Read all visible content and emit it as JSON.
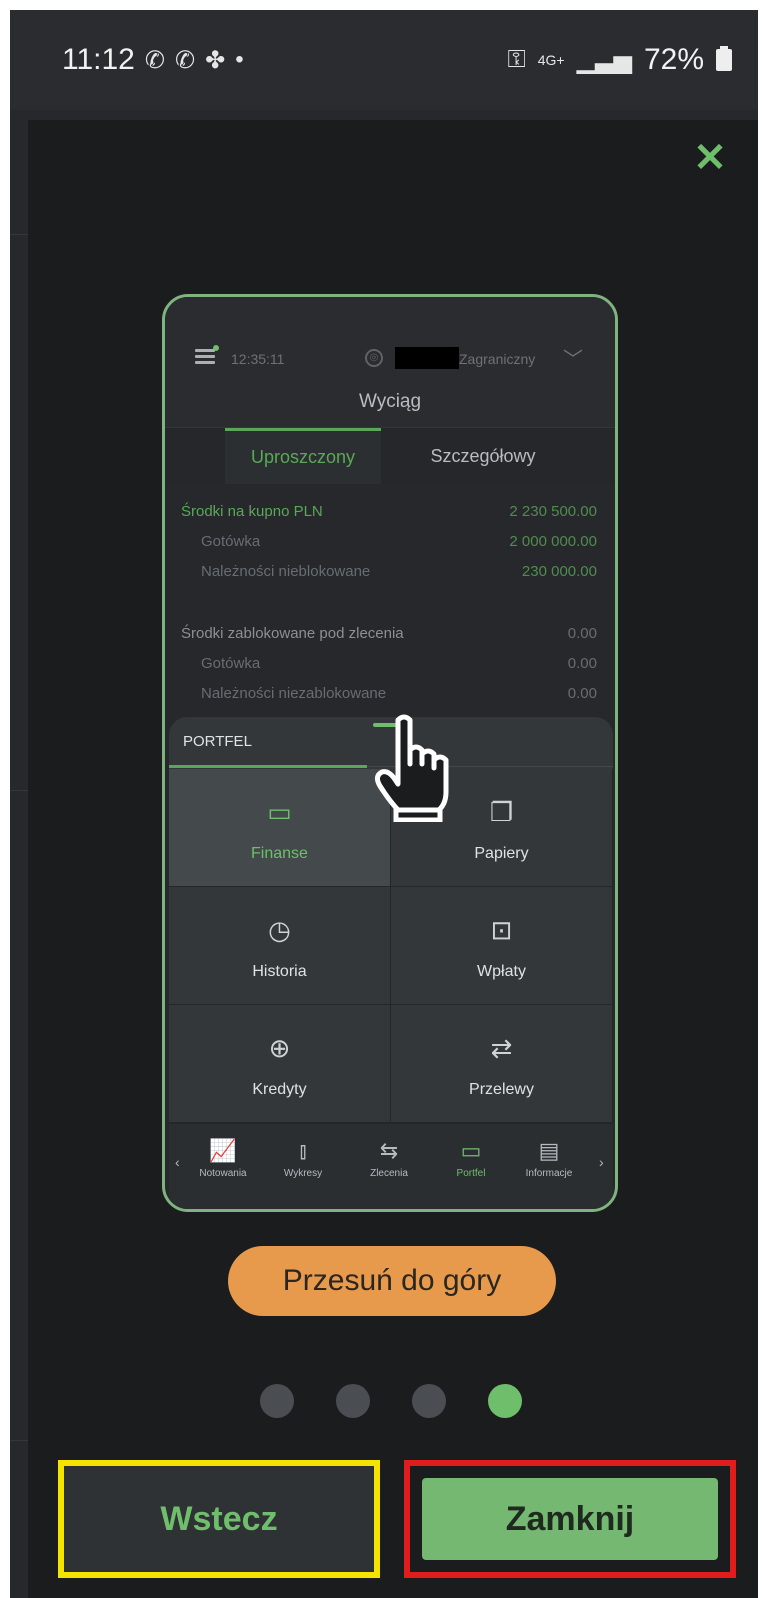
{
  "statusbar": {
    "time": "11:12",
    "left_icons": "📞 📞 ⚙ •",
    "network": "4G+",
    "battery": "72%"
  },
  "modal": {
    "close_icon": "close-icon",
    "accent_color": "#6fbe6c",
    "hint": "Przesuń do góry",
    "page_count": 4,
    "active_page": 4,
    "back_label": "Wstecz",
    "close_label": "Zamknij"
  },
  "preview": {
    "time": "12:35:11",
    "account": "Zagraniczny",
    "title": "Wyciąg",
    "tabs": [
      "Uproszczony",
      "Szczegółowy"
    ],
    "rows": [
      {
        "label": "Środki na kupno PLN",
        "value": "2 230 500.00"
      },
      {
        "label": "Gotówka",
        "value": "2 000 000.00"
      },
      {
        "label": "Należności nieblokowane",
        "value": "230 000.00"
      },
      {
        "label": "Środki zablokowane pod zlecenia",
        "value": "0.00"
      },
      {
        "label": "Gotówka",
        "value": "0.00"
      },
      {
        "label": "Należności niezablokowane",
        "value": "0.00"
      }
    ],
    "sheet_title": "PORTFEL",
    "grid": [
      {
        "label": "Finanse",
        "icon": "wallet-icon"
      },
      {
        "label": "Papiery",
        "icon": "papers-icon"
      },
      {
        "label": "Historia",
        "icon": "history-icon"
      },
      {
        "label": "Wpłaty",
        "icon": "deposit-icon"
      },
      {
        "label": "Kredyty",
        "icon": "coins-icon"
      },
      {
        "label": "Przelewy",
        "icon": "transfer-icon"
      }
    ],
    "nav": [
      {
        "label": "Notowania",
        "icon": "chart-icon"
      },
      {
        "label": "Wykresy",
        "icon": "candles-icon"
      },
      {
        "label": "Zlecenia",
        "icon": "orders-icon"
      },
      {
        "label": "Portfel",
        "icon": "wallet-icon"
      },
      {
        "label": "Informacje",
        "icon": "news-icon"
      }
    ]
  }
}
